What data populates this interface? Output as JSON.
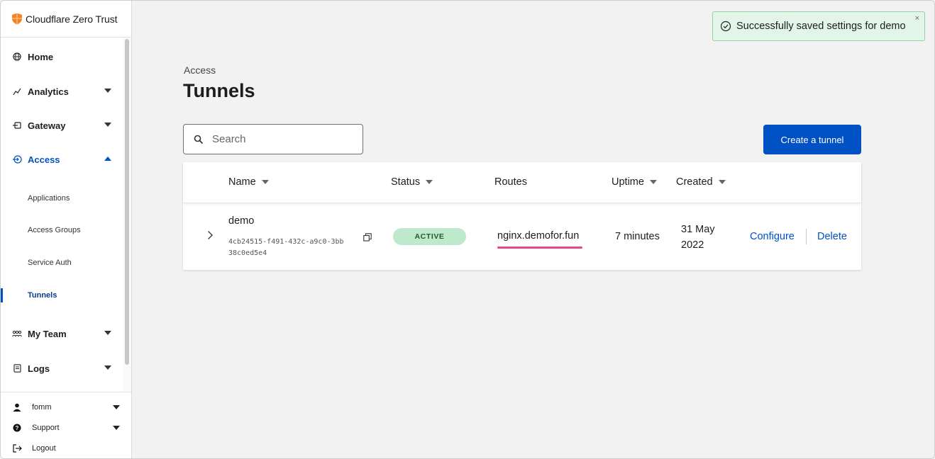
{
  "brand": {
    "name": "Cloudflare Zero Trust",
    "accent": "#f6821f"
  },
  "sidebar": {
    "items": [
      {
        "label": "Home",
        "icon": "globe-icon"
      },
      {
        "label": "Analytics",
        "icon": "analytics-icon"
      },
      {
        "label": "Gateway",
        "icon": "gateway-icon"
      },
      {
        "label": "Access",
        "icon": "access-icon"
      },
      {
        "label": "My Team",
        "icon": "team-icon"
      },
      {
        "label": "Logs",
        "icon": "logs-icon"
      }
    ],
    "access_sub": [
      "Applications",
      "Access Groups",
      "Service Auth",
      "Tunnels"
    ],
    "footer": [
      {
        "label": "fomm",
        "icon": "user-icon"
      },
      {
        "label": "Support",
        "icon": "help-icon"
      },
      {
        "label": "Logout",
        "icon": "logout-icon"
      }
    ]
  },
  "page": {
    "eyebrow": "Access",
    "title": "Tunnels"
  },
  "search": {
    "placeholder": "Search"
  },
  "actions": {
    "create": "Create a tunnel"
  },
  "table": {
    "columns": [
      "Name",
      "Status",
      "Routes",
      "Uptime",
      "Created"
    ],
    "rows": [
      {
        "name": "demo",
        "id": "4cb24515-f491-432c-a9c0-3bb38c0ed5e4",
        "status": "ACTIVE",
        "route": "nginx.demofor.fun",
        "uptime": "7 minutes",
        "created": "31 May 2022",
        "configure": "Configure",
        "delete": "Delete"
      }
    ]
  },
  "toast": {
    "message": "Successfully saved settings for demo",
    "close": "×"
  },
  "colors": {
    "primary": "#0051c3",
    "success_bg": "#e3f5e8",
    "badge": "#bfe9cc",
    "route_underline": "#e9458b"
  }
}
